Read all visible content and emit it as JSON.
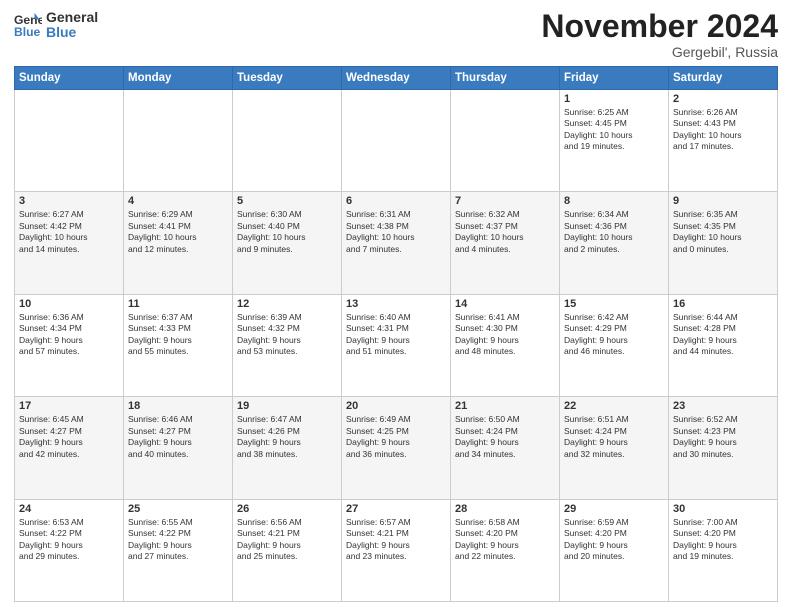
{
  "logo": {
    "line1": "General",
    "line2": "Blue"
  },
  "title": "November 2024",
  "location": "Gergebil', Russia",
  "days_header": [
    "Sunday",
    "Monday",
    "Tuesday",
    "Wednesday",
    "Thursday",
    "Friday",
    "Saturday"
  ],
  "weeks": [
    [
      {
        "day": "",
        "info": ""
      },
      {
        "day": "",
        "info": ""
      },
      {
        "day": "",
        "info": ""
      },
      {
        "day": "",
        "info": ""
      },
      {
        "day": "",
        "info": ""
      },
      {
        "day": "1",
        "info": "Sunrise: 6:25 AM\nSunset: 4:45 PM\nDaylight: 10 hours\nand 19 minutes."
      },
      {
        "day": "2",
        "info": "Sunrise: 6:26 AM\nSunset: 4:43 PM\nDaylight: 10 hours\nand 17 minutes."
      }
    ],
    [
      {
        "day": "3",
        "info": "Sunrise: 6:27 AM\nSunset: 4:42 PM\nDaylight: 10 hours\nand 14 minutes."
      },
      {
        "day": "4",
        "info": "Sunrise: 6:29 AM\nSunset: 4:41 PM\nDaylight: 10 hours\nand 12 minutes."
      },
      {
        "day": "5",
        "info": "Sunrise: 6:30 AM\nSunset: 4:40 PM\nDaylight: 10 hours\nand 9 minutes."
      },
      {
        "day": "6",
        "info": "Sunrise: 6:31 AM\nSunset: 4:38 PM\nDaylight: 10 hours\nand 7 minutes."
      },
      {
        "day": "7",
        "info": "Sunrise: 6:32 AM\nSunset: 4:37 PM\nDaylight: 10 hours\nand 4 minutes."
      },
      {
        "day": "8",
        "info": "Sunrise: 6:34 AM\nSunset: 4:36 PM\nDaylight: 10 hours\nand 2 minutes."
      },
      {
        "day": "9",
        "info": "Sunrise: 6:35 AM\nSunset: 4:35 PM\nDaylight: 10 hours\nand 0 minutes."
      }
    ],
    [
      {
        "day": "10",
        "info": "Sunrise: 6:36 AM\nSunset: 4:34 PM\nDaylight: 9 hours\nand 57 minutes."
      },
      {
        "day": "11",
        "info": "Sunrise: 6:37 AM\nSunset: 4:33 PM\nDaylight: 9 hours\nand 55 minutes."
      },
      {
        "day": "12",
        "info": "Sunrise: 6:39 AM\nSunset: 4:32 PM\nDaylight: 9 hours\nand 53 minutes."
      },
      {
        "day": "13",
        "info": "Sunrise: 6:40 AM\nSunset: 4:31 PM\nDaylight: 9 hours\nand 51 minutes."
      },
      {
        "day": "14",
        "info": "Sunrise: 6:41 AM\nSunset: 4:30 PM\nDaylight: 9 hours\nand 48 minutes."
      },
      {
        "day": "15",
        "info": "Sunrise: 6:42 AM\nSunset: 4:29 PM\nDaylight: 9 hours\nand 46 minutes."
      },
      {
        "day": "16",
        "info": "Sunrise: 6:44 AM\nSunset: 4:28 PM\nDaylight: 9 hours\nand 44 minutes."
      }
    ],
    [
      {
        "day": "17",
        "info": "Sunrise: 6:45 AM\nSunset: 4:27 PM\nDaylight: 9 hours\nand 42 minutes."
      },
      {
        "day": "18",
        "info": "Sunrise: 6:46 AM\nSunset: 4:27 PM\nDaylight: 9 hours\nand 40 minutes."
      },
      {
        "day": "19",
        "info": "Sunrise: 6:47 AM\nSunset: 4:26 PM\nDaylight: 9 hours\nand 38 minutes."
      },
      {
        "day": "20",
        "info": "Sunrise: 6:49 AM\nSunset: 4:25 PM\nDaylight: 9 hours\nand 36 minutes."
      },
      {
        "day": "21",
        "info": "Sunrise: 6:50 AM\nSunset: 4:24 PM\nDaylight: 9 hours\nand 34 minutes."
      },
      {
        "day": "22",
        "info": "Sunrise: 6:51 AM\nSunset: 4:24 PM\nDaylight: 9 hours\nand 32 minutes."
      },
      {
        "day": "23",
        "info": "Sunrise: 6:52 AM\nSunset: 4:23 PM\nDaylight: 9 hours\nand 30 minutes."
      }
    ],
    [
      {
        "day": "24",
        "info": "Sunrise: 6:53 AM\nSunset: 4:22 PM\nDaylight: 9 hours\nand 29 minutes."
      },
      {
        "day": "25",
        "info": "Sunrise: 6:55 AM\nSunset: 4:22 PM\nDaylight: 9 hours\nand 27 minutes."
      },
      {
        "day": "26",
        "info": "Sunrise: 6:56 AM\nSunset: 4:21 PM\nDaylight: 9 hours\nand 25 minutes."
      },
      {
        "day": "27",
        "info": "Sunrise: 6:57 AM\nSunset: 4:21 PM\nDaylight: 9 hours\nand 23 minutes."
      },
      {
        "day": "28",
        "info": "Sunrise: 6:58 AM\nSunset: 4:20 PM\nDaylight: 9 hours\nand 22 minutes."
      },
      {
        "day": "29",
        "info": "Sunrise: 6:59 AM\nSunset: 4:20 PM\nDaylight: 9 hours\nand 20 minutes."
      },
      {
        "day": "30",
        "info": "Sunrise: 7:00 AM\nSunset: 4:20 PM\nDaylight: 9 hours\nand 19 minutes."
      }
    ]
  ]
}
